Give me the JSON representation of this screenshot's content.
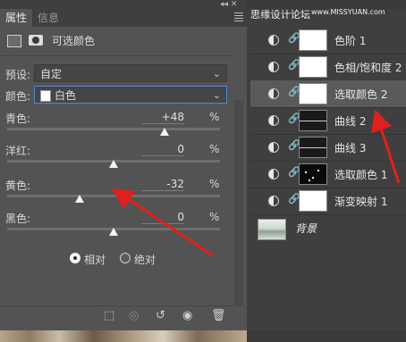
{
  "tabs": {
    "properties": "属性",
    "info": "信息"
  },
  "adjustment_title": "可选颜色",
  "preset": {
    "label": "预设:",
    "value": "自定"
  },
  "colors": {
    "label": "颜色:",
    "value": "白色"
  },
  "sliders": [
    {
      "label": "青色:",
      "value": "+48",
      "unit": "%",
      "level": 0.74
    },
    {
      "label": "洋红:",
      "value": "0",
      "unit": "%",
      "level": 0.5
    },
    {
      "label": "黄色:",
      "value": "-32",
      "unit": "%",
      "level": 0.34
    },
    {
      "label": "黑色:",
      "value": "0",
      "unit": "%",
      "level": 0.5
    }
  ],
  "method": {
    "relative": "相对",
    "absolute": "绝对",
    "selected": "relative"
  },
  "watermark": {
    "text": "思缘设计论坛",
    "url": "www.MISSYUAN.com"
  },
  "layers": [
    {
      "name": "色阶 1",
      "thumb": "white",
      "selected": false
    },
    {
      "name": "色相/饱和度 2",
      "thumb": "white",
      "selected": false
    },
    {
      "name": "选取颜色 2",
      "thumb": "white",
      "selected": true
    },
    {
      "name": "曲线 2",
      "thumb": "curve",
      "selected": false
    },
    {
      "name": "曲线 3",
      "thumb": "curve",
      "selected": false
    },
    {
      "name": "选取颜色 1",
      "thumb": "dots",
      "selected": false
    },
    {
      "name": "渐变映射 1",
      "thumb": "white",
      "selected": false
    }
  ],
  "background_layer": {
    "name": "背景"
  },
  "colors_meta": {
    "panel_bg": "#535353",
    "dark_bg": "#3f3f3f",
    "accent_border": "#4a8cd6",
    "arrow_red": "#e0201c"
  }
}
